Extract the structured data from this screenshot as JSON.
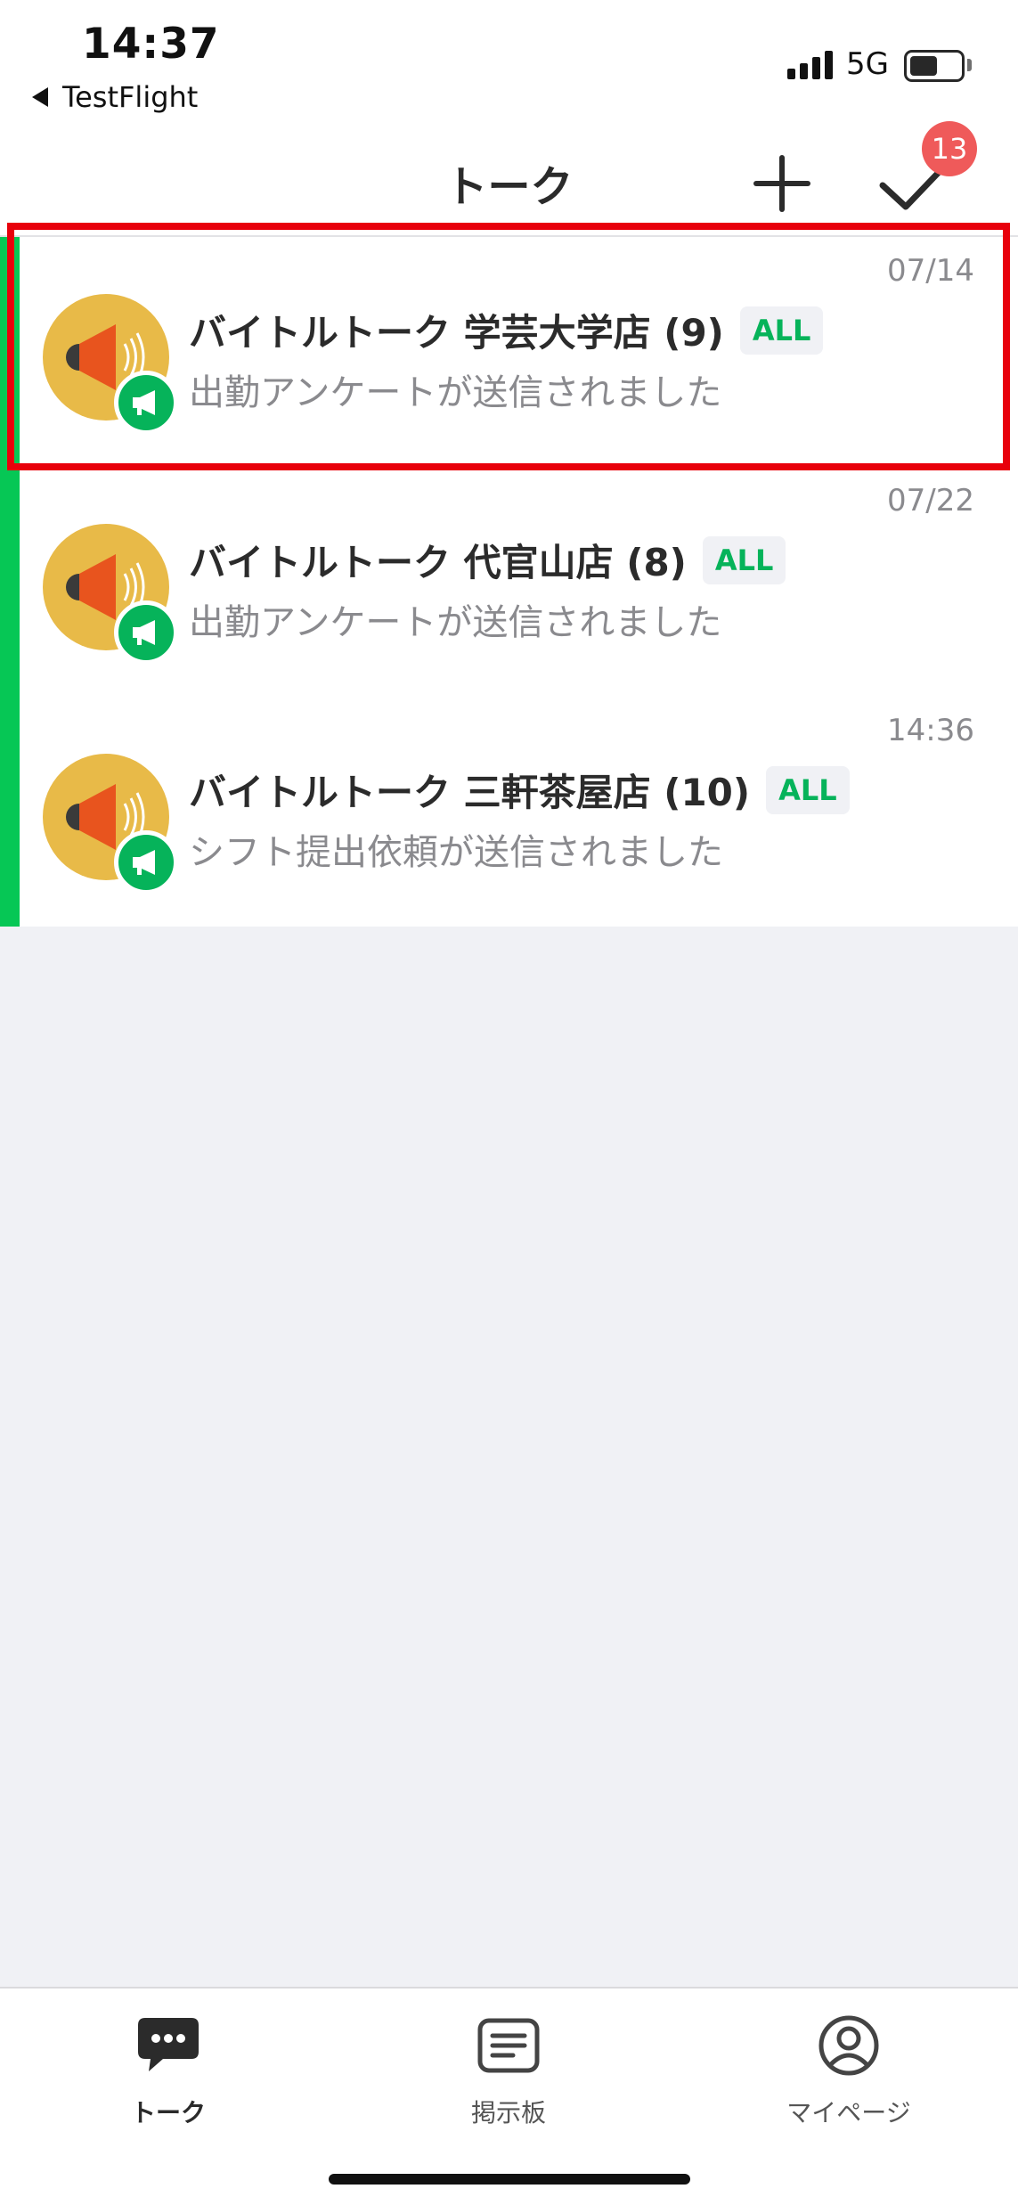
{
  "status_bar": {
    "time": "14:37",
    "back_app": "TestFlight",
    "network": "5G"
  },
  "nav": {
    "title": "トーク",
    "add_icon": "plus-icon",
    "check_icon": "checkmark-icon",
    "badge_count": "13"
  },
  "talk_list": [
    {
      "title": "バイトルトーク 学芸大学店 (9)",
      "tag": "ALL",
      "message": "出勤アンケートが送信されました",
      "date": "07/14",
      "highlighted": true
    },
    {
      "title": "バイトルトーク 代官山店 (8)",
      "tag": "ALL",
      "message": "出勤アンケートが送信されました",
      "date": "07/22",
      "highlighted": false
    },
    {
      "title": "バイトルトーク 三軒茶屋店 (10)",
      "tag": "ALL",
      "message": "シフト提出依頼が送信されました",
      "date": "14:36",
      "highlighted": false
    }
  ],
  "tabbar": {
    "tabs": [
      {
        "label": "トーク",
        "icon": "chat-bubble-icon",
        "active": true
      },
      {
        "label": "掲示板",
        "icon": "board-icon",
        "active": false
      },
      {
        "label": "マイページ",
        "icon": "profile-icon",
        "active": false
      }
    ]
  },
  "colors": {
    "accent_green": "#06C755",
    "badge_red": "#EF5A5A",
    "highlight_red": "#E8000B",
    "avatar_yellow": "#E8BA48"
  }
}
